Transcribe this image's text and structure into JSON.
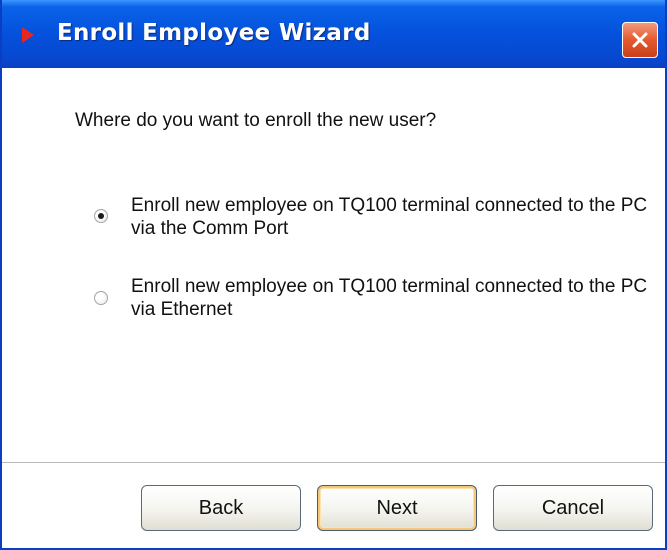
{
  "window": {
    "title": "Enroll Employee Wizard",
    "icon": "red-arrow-icon",
    "close_icon": "close-icon"
  },
  "content": {
    "question": "Where do you want to enroll the new user?",
    "options": [
      {
        "label": "Enroll new employee on TQ100 terminal connected to the PC via the Comm Port",
        "selected": true
      },
      {
        "label": "Enroll new employee on TQ100 terminal connected to the PC via Ethernet",
        "selected": false
      }
    ]
  },
  "buttons": {
    "back": "Back",
    "next": "Next",
    "cancel": "Cancel",
    "default": "next"
  },
  "colors": {
    "titlebar": "#0451dc",
    "close_button": "#e5592f",
    "default_button_focus": "#f5c77a"
  }
}
